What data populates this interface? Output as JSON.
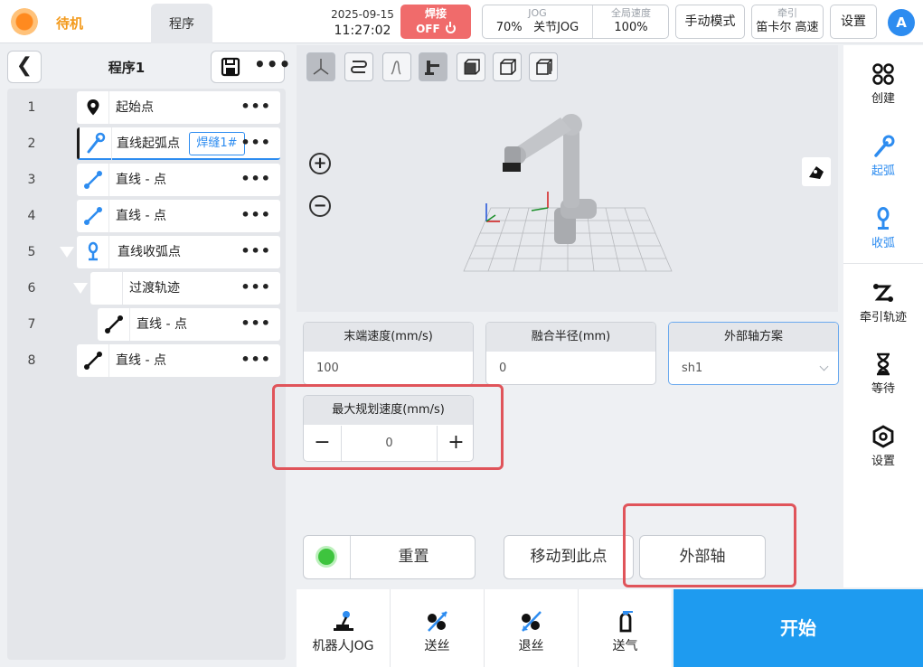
{
  "header": {
    "status": "待机",
    "tab": "程序",
    "date": "2025-09-15",
    "time": "11:27:02",
    "weld_label": "焊接",
    "weld_state": "OFF",
    "jog_header": "JOG",
    "jog_speed": "70%",
    "jog_mode": "关节JOG",
    "global_speed_header": "全局速度",
    "global_speed": "100%",
    "manual_mode": "手动模式",
    "traction_header": "牵引",
    "traction_value": "笛卡尔 高速",
    "settings": "设置",
    "avatar": "A"
  },
  "program": {
    "title": "程序1",
    "rows": [
      {
        "num": "1",
        "label": "起始点",
        "icon": "location-pin-icon"
      },
      {
        "num": "2",
        "label": "直线起弧点",
        "icon": "arc-start-icon",
        "tag": "焊缝1#"
      },
      {
        "num": "3",
        "label": "直线 - 点",
        "icon": "line-point-icon"
      },
      {
        "num": "4",
        "label": "直线 - 点",
        "icon": "line-point-icon"
      },
      {
        "num": "5",
        "label": "直线收弧点",
        "icon": "arc-end-icon"
      },
      {
        "num": "6",
        "label": "过渡轨迹",
        "icon": ""
      },
      {
        "num": "7",
        "label": "直线 - 点",
        "icon": "line-point-icon"
      },
      {
        "num": "8",
        "label": "直线 - 点",
        "icon": "line-point-icon"
      }
    ]
  },
  "form": {
    "end_speed_label": "末端速度(mm/s)",
    "end_speed_value": "100",
    "blend_radius_label": "融合半径(mm)",
    "blend_radius_value": "0",
    "ext_axis_scheme_label": "外部轴方案",
    "ext_axis_scheme_value": "sh1",
    "max_speed_label": "最大规划速度(mm/s)",
    "max_speed_value": "0",
    "minus": "−",
    "plus": "+"
  },
  "actions": {
    "reset": "重置",
    "move_to": "移动到此点",
    "external_axis": "外部轴"
  },
  "sidebar": {
    "items": [
      {
        "label": "创建",
        "icon": "create-icon"
      },
      {
        "label": "起弧",
        "icon": "arc-start-icon"
      },
      {
        "label": "收弧",
        "icon": "arc-end-icon"
      },
      {
        "label": "牵引轨迹",
        "icon": "traction-path-icon"
      },
      {
        "label": "等待",
        "icon": "hourglass-icon"
      },
      {
        "label": "设置",
        "icon": "settings-hex-icon"
      }
    ]
  },
  "bottom": {
    "robot_jog": "机器人JOG",
    "feed_wire": "送丝",
    "retract_wire": "退丝",
    "gas": "送气",
    "start": "开始"
  },
  "colors": {
    "accent": "#1e9bf0",
    "status": "#f39a1c",
    "weld_off": "#f06b6b",
    "highlight": "#e0545a"
  }
}
